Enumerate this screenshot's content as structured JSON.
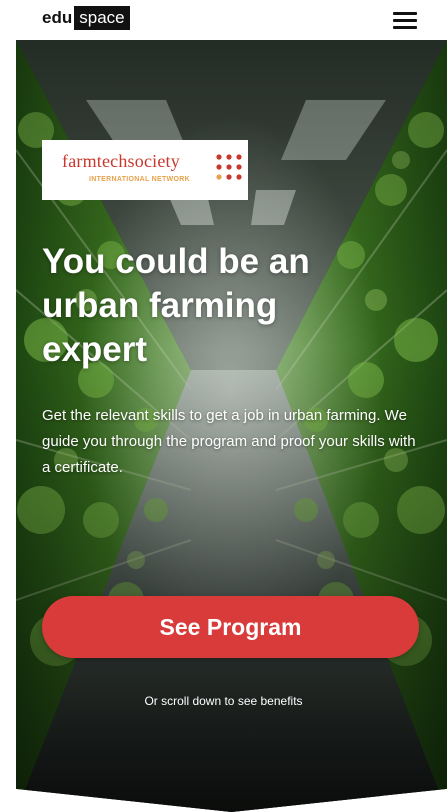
{
  "header": {
    "logo_part1": "edu",
    "logo_part2": "space",
    "menu_icon": "hamburger-menu-icon"
  },
  "partner": {
    "name": "farmtechsociety",
    "tagline": "INTERNATIONAL NETWORK",
    "dots_icon": "dot-grid-icon",
    "color_primary": "#c8372d",
    "color_secondary": "#e8a24a"
  },
  "hero": {
    "headline_line1": "You could be an",
    "headline_line2": "urban farming",
    "headline_line3": "expert",
    "subtext": "Get the relevant skills to get a job in urban farming. We guide you through the program and proof your skills with a certificate.",
    "cta_label": "See Program",
    "scroll_hint": "Or scroll down to see benefits",
    "accent_color": "#d93a3a"
  }
}
